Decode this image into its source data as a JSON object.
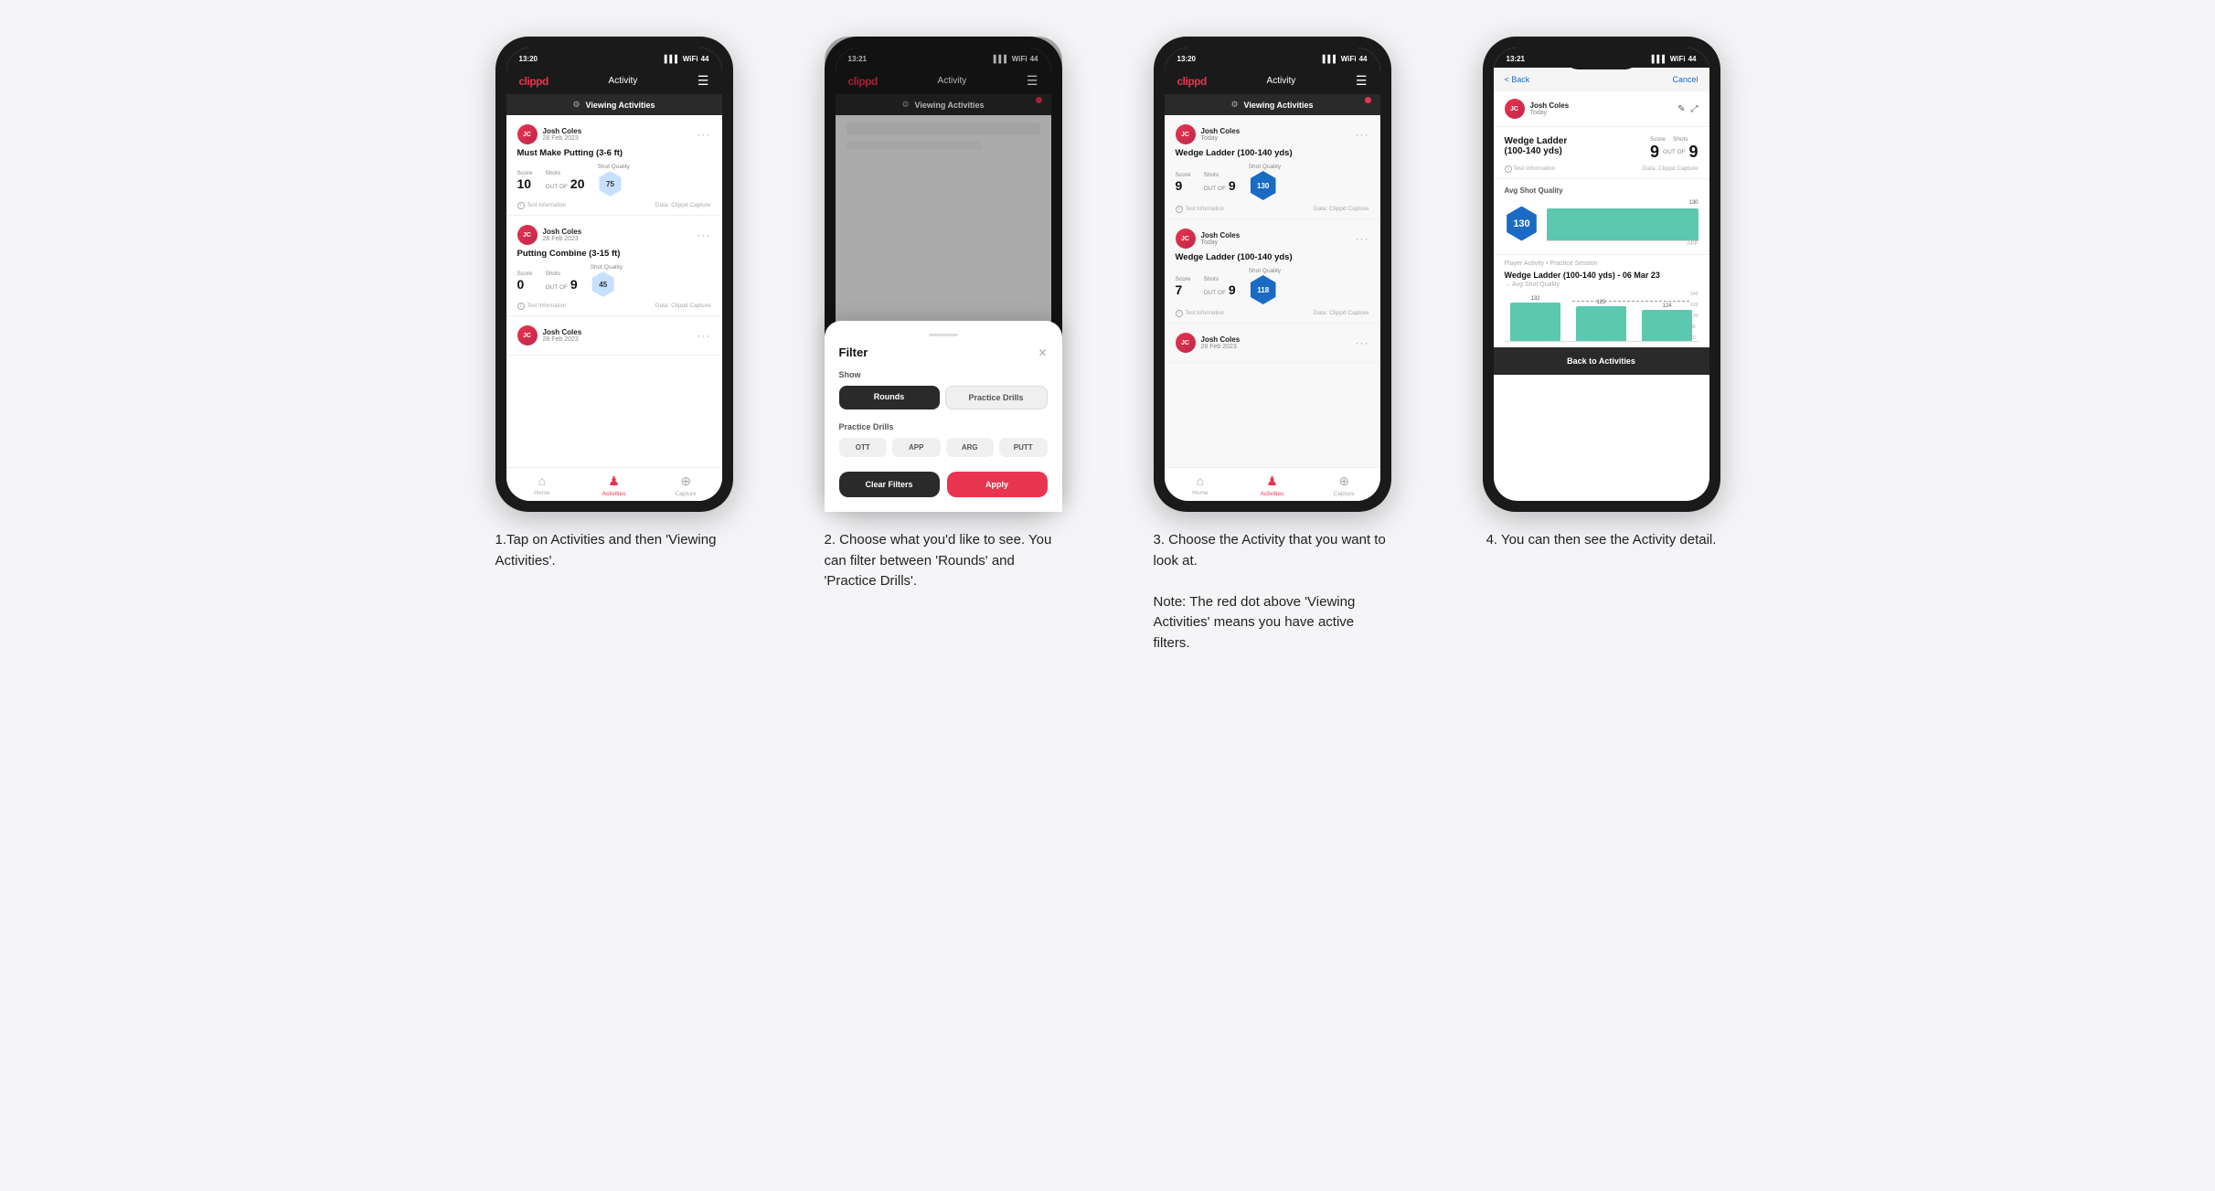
{
  "phones": [
    {
      "id": "phone1",
      "statusBar": {
        "time": "13:20",
        "signal": "▌▌▌",
        "wifi": "WiFi",
        "battery": "44"
      },
      "nav": {
        "logo": "clippd",
        "title": "Activity",
        "menu": "☰"
      },
      "viewingBar": {
        "label": "Viewing Activities",
        "hasRedDot": false
      },
      "cards": [
        {
          "userName": "Josh Coles",
          "userDate": "28 Feb 2023",
          "title": "Must Make Putting (3-6 ft)",
          "scoreLabel": "Score",
          "scoreValue": "10",
          "shotsLabel": "Shots",
          "shotsOutOf": "OUT OF",
          "shotsValue": "20",
          "shotQualityLabel": "Shot Quality",
          "shotQualityValue": "75",
          "testInfo": "Test Information",
          "dataInfo": "Data: Clippd Capture"
        },
        {
          "userName": "Josh Coles",
          "userDate": "28 Feb 2023",
          "title": "Putting Combine (3-15 ft)",
          "scoreLabel": "Score",
          "scoreValue": "0",
          "shotsLabel": "Shots",
          "shotsOutOf": "OUT OF",
          "shotsValue": "9",
          "shotQualityLabel": "Shot Quality",
          "shotQualityValue": "45",
          "testInfo": "Test Information",
          "dataInfo": "Data: Clippd Capture"
        },
        {
          "userName": "Josh Coles",
          "userDate": "28 Feb 2023",
          "title": "",
          "scoreLabel": "",
          "scoreValue": "",
          "shotsLabel": "",
          "shotsValue": "",
          "shotQualityValue": ""
        }
      ],
      "bottomNav": [
        {
          "label": "Home",
          "icon": "⌂",
          "active": false
        },
        {
          "label": "Activities",
          "icon": "♟",
          "active": true
        },
        {
          "label": "Capture",
          "icon": "⊕",
          "active": false
        }
      ]
    },
    {
      "id": "phone2",
      "statusBar": {
        "time": "13:21",
        "signal": "▌▌▌",
        "wifi": "WiFi",
        "battery": "44"
      },
      "nav": {
        "logo": "clippd",
        "title": "Activity",
        "menu": "☰"
      },
      "viewingBar": {
        "label": "Viewing Activities",
        "hasRedDot": true
      },
      "filter": {
        "title": "Filter",
        "showLabel": "Show",
        "showOptions": [
          "Rounds",
          "Practice Drills"
        ],
        "activeShow": "Rounds",
        "drillsLabel": "Practice Drills",
        "drills": [
          "OTT",
          "APP",
          "ARG",
          "PUTT"
        ],
        "clearLabel": "Clear Filters",
        "applyLabel": "Apply"
      }
    },
    {
      "id": "phone3",
      "statusBar": {
        "time": "13:20",
        "signal": "▌▌▌",
        "wifi": "WiFi",
        "battery": "44"
      },
      "nav": {
        "logo": "clippd",
        "title": "Activity",
        "menu": "☰"
      },
      "viewingBar": {
        "label": "Viewing Activities",
        "hasRedDot": true
      },
      "cards": [
        {
          "userName": "Josh Coles",
          "userDate": "Today",
          "title": "Wedge Ladder (100-140 yds)",
          "scoreLabel": "Score",
          "scoreValue": "9",
          "shotsLabel": "Shots",
          "shotsOutOf": "OUT OF",
          "shotsValue": "9",
          "shotQualityLabel": "Shot Quality",
          "shotQualityValue": "130",
          "shotQualityDark": true,
          "testInfo": "Test Information",
          "dataInfo": "Data: Clippd Capture"
        },
        {
          "userName": "Josh Coles",
          "userDate": "Today",
          "title": "Wedge Ladder (100-140 yds)",
          "scoreLabel": "Score",
          "scoreValue": "7",
          "shotsLabel": "Shots",
          "shotsOutOf": "OUT OF",
          "shotsValue": "9",
          "shotQualityLabel": "Shot Quality",
          "shotQualityValue": "118",
          "shotQualityDark": true,
          "testInfo": "Test Information",
          "dataInfo": "Data: Clippd Capture"
        },
        {
          "userName": "Josh Coles",
          "userDate": "28 Feb 2023",
          "title": "",
          "scoreLabel": ""
        }
      ],
      "bottomNav": [
        {
          "label": "Home",
          "icon": "⌂",
          "active": false
        },
        {
          "label": "Activities",
          "icon": "♟",
          "active": true
        },
        {
          "label": "Capture",
          "icon": "⊕",
          "active": false
        }
      ]
    },
    {
      "id": "phone4",
      "statusBar": {
        "time": "13:21",
        "signal": "▌▌▌",
        "wifi": "WiFi",
        "battery": "44"
      },
      "nav": {
        "back": "< Back",
        "cancel": "Cancel"
      },
      "user": {
        "name": "Josh Coles",
        "date": "Today"
      },
      "drillTitle": "Wedge Ladder\n(100-140 yds)",
      "scoreLabel": "Score",
      "scoreValue": "9",
      "shotsLabel": "Shots",
      "shotsValue": "9",
      "outOfLabel": "OUT OF",
      "testInfo": "Test Information",
      "dataCapture": "Data: Clippd Capture",
      "avgShotQuality": {
        "label": "Avg Shot Quality",
        "value": "130"
      },
      "chartLabel": "APP",
      "sessionLink": "Player Activity • Practice Session",
      "sessionTitle": "Wedge Ladder (100-140 yds) - 06 Mar 23",
      "avgLabel": "→ Avg Shot Quality",
      "bars": [
        {
          "value": 132,
          "label": ""
        },
        {
          "value": 129,
          "label": ""
        },
        {
          "value": 124,
          "label": ""
        }
      ],
      "backButton": "Back to Activities"
    }
  ],
  "steps": [
    {
      "id": "step1",
      "text": "1.Tap on Activities and then 'Viewing Activities'."
    },
    {
      "id": "step2",
      "text": "2. Choose what you'd like to see. You can filter between 'Rounds' and 'Practice Drills'."
    },
    {
      "id": "step3",
      "text": "3. Choose the Activity that you want to look at.\n\nNote: The red dot above 'Viewing Activities' means you have active filters."
    },
    {
      "id": "step4",
      "text": "4. You can then see the Activity detail."
    }
  ]
}
